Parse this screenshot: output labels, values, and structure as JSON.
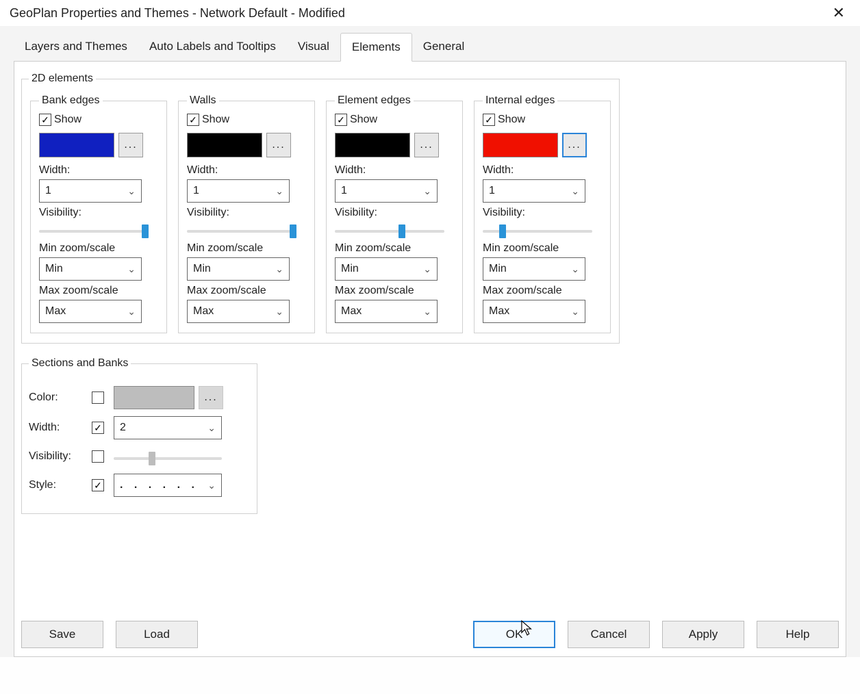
{
  "window": {
    "title": "GeoPlan Properties and Themes - Network Default - Modified"
  },
  "tabs": [
    {
      "label": "Layers and Themes"
    },
    {
      "label": "Auto Labels and Tooltips"
    },
    {
      "label": "Visual"
    },
    {
      "label": "Elements",
      "active": true
    },
    {
      "label": "General"
    }
  ],
  "group2d": {
    "legend": "2D elements"
  },
  "edges": {
    "bank": {
      "legend": "Bank edges",
      "show": "Show",
      "color": "blue",
      "width_label": "Width:",
      "width": "1",
      "visibility_label": "Visibility:",
      "min_label": "Min zoom/scale",
      "min": "Min",
      "max_label": "Max zoom/scale",
      "max": "Max",
      "slider_pos": "pos-100"
    },
    "walls": {
      "legend": "Walls",
      "show": "Show",
      "color": "black",
      "width_label": "Width:",
      "width": "1",
      "visibility_label": "Visibility:",
      "min_label": "Min zoom/scale",
      "min": "Min",
      "max_label": "Max zoom/scale",
      "max": "Max",
      "slider_pos": "pos-100"
    },
    "element": {
      "legend": "Element edges",
      "show": "Show",
      "color": "black",
      "width_label": "Width:",
      "width": "1",
      "visibility_label": "Visibility:",
      "min_label": "Min zoom/scale",
      "min": "Min",
      "max_label": "Max zoom/scale",
      "max": "Max",
      "slider_pos": "pos-58"
    },
    "internal": {
      "legend": "Internal edges",
      "show": "Show",
      "color": "red",
      "width_label": "Width:",
      "width": "1",
      "visibility_label": "Visibility:",
      "min_label": "Min zoom/scale",
      "min": "Min",
      "max_label": "Max zoom/scale",
      "max": "Max",
      "slider_pos": "pos-15"
    }
  },
  "sections": {
    "legend": "Sections and Banks",
    "color_label": "Color:",
    "width_label": "Width:",
    "width": "2",
    "visibility_label": "Visibility:",
    "style_label": "Style:",
    "style_value": ". . . . . ."
  },
  "buttons": {
    "save": "Save",
    "load": "Load",
    "ok": "OK",
    "cancel": "Cancel",
    "apply": "Apply",
    "help": "Help",
    "dots": "..."
  }
}
